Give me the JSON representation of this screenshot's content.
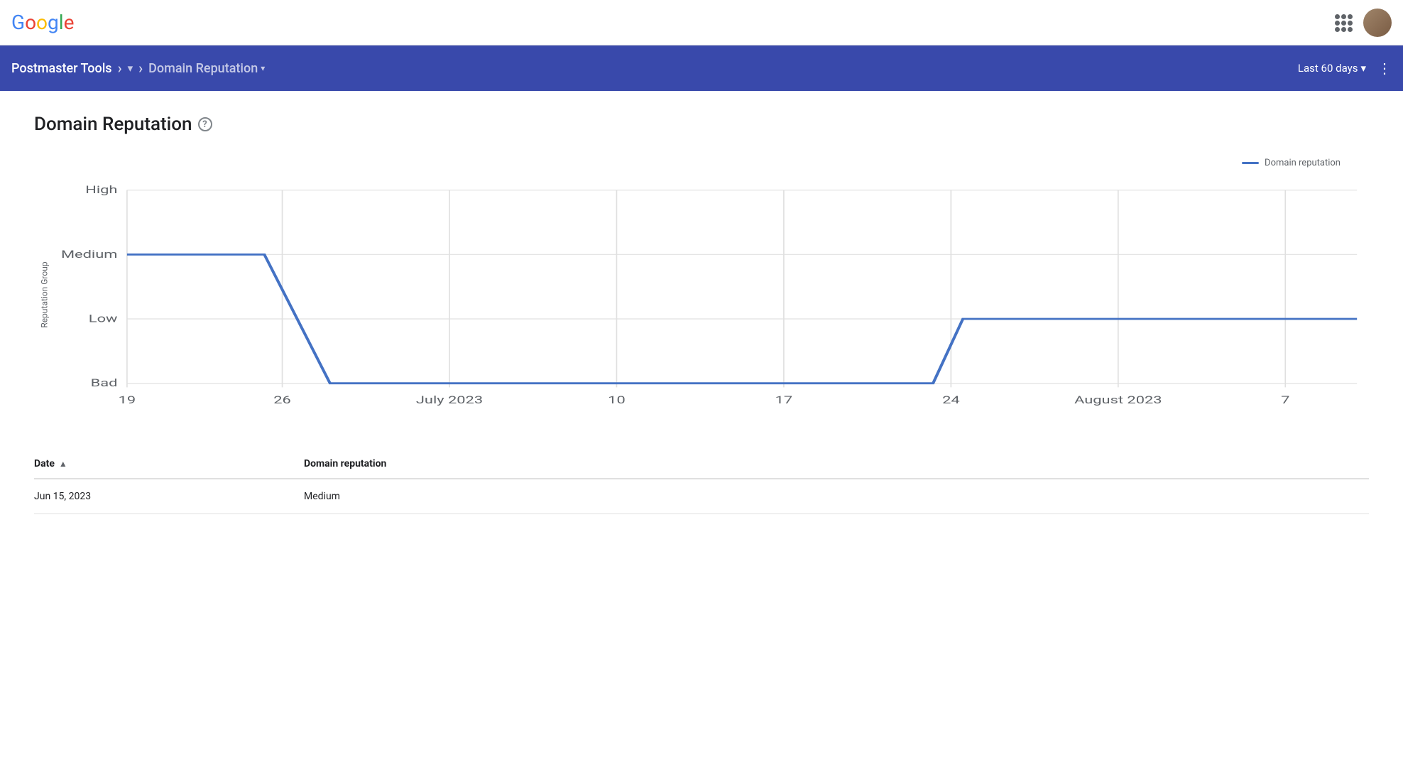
{
  "app": {
    "name": "Google",
    "letters": [
      "G",
      "o",
      "o",
      "g",
      "l",
      "e"
    ]
  },
  "topbar": {
    "grid_icon_label": "Google apps"
  },
  "navbar": {
    "tool_name": "Postmaster Tools",
    "domain_dropdown_placeholder": "",
    "section": "Domain Reputation",
    "time_range": "Last 60 days"
  },
  "page": {
    "title": "Domain Reputation",
    "help_tooltip": "?"
  },
  "chart": {
    "legend_label": "Domain reputation",
    "y_axis_label": "Reputation Group",
    "y_labels": [
      "High",
      "Medium",
      "Low",
      "Bad"
    ],
    "x_labels": [
      "19",
      "26",
      "July 2023",
      "10",
      "17",
      "24",
      "August 2023",
      "7"
    ],
    "grid_lines": 4
  },
  "table": {
    "col_date": "Date",
    "col_reputation": "Domain reputation",
    "sort_indicator": "▲",
    "rows": [
      {
        "date": "Jun 15, 2023",
        "reputation": "Medium"
      }
    ]
  }
}
